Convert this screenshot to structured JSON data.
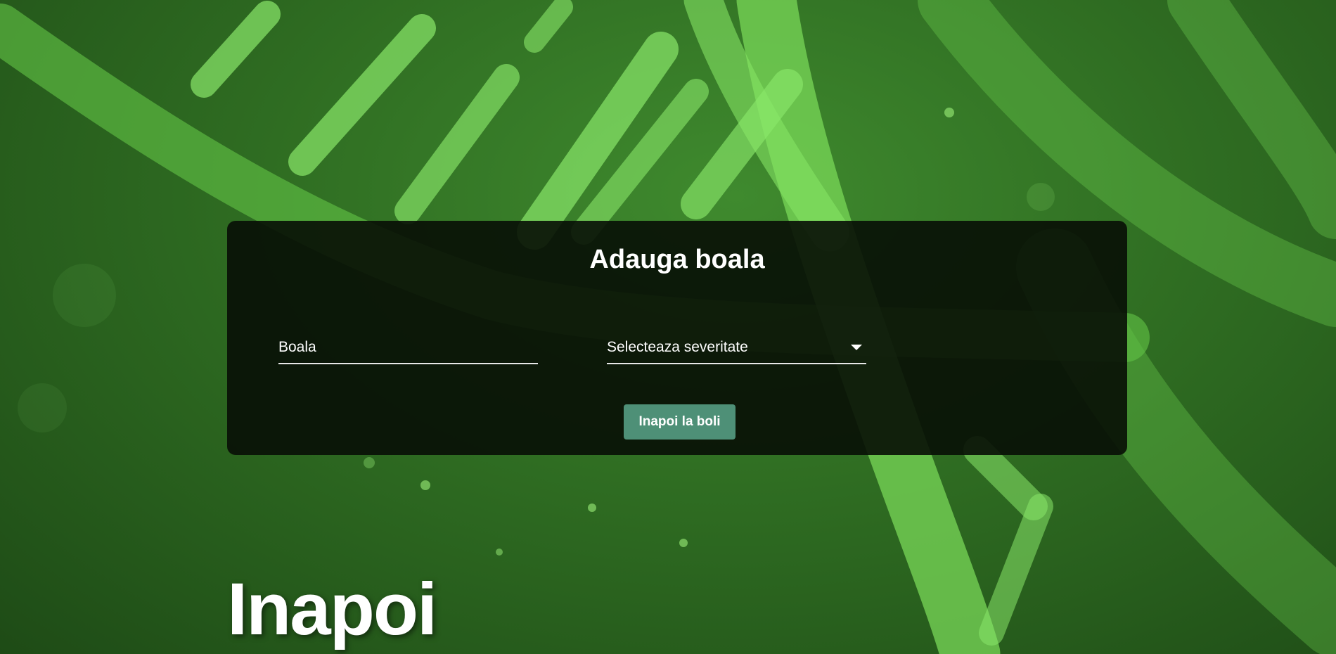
{
  "form": {
    "title": "Adauga boala",
    "disease_field": {
      "placeholder": "Boala",
      "value": ""
    },
    "severity_select": {
      "selected": "Selecteaza severitate"
    },
    "back_button_label": "Inapoi la boli"
  },
  "back_link": {
    "label": "Inapoi"
  },
  "colors": {
    "background_green": "#2f6d22",
    "card_bg": "#080e06",
    "button_teal": "#4e9077"
  }
}
